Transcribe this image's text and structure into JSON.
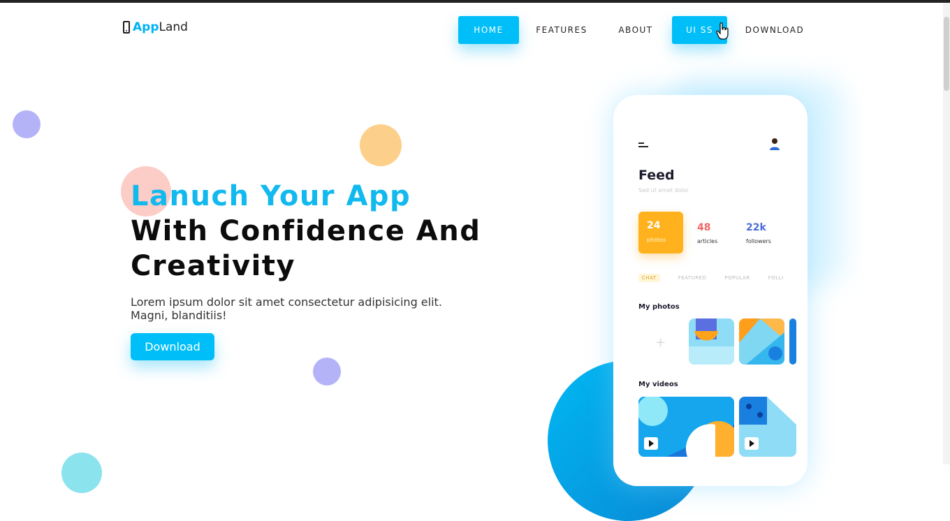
{
  "logo": {
    "app": "App",
    "land": "Land"
  },
  "nav": {
    "items": [
      {
        "label": "HOME",
        "active": true
      },
      {
        "label": "FEATURES",
        "active": false
      },
      {
        "label": "ABOUT",
        "active": false
      },
      {
        "label": "UI SS",
        "active": true
      },
      {
        "label": "DOWNLOAD",
        "active": false
      }
    ]
  },
  "hero": {
    "line1": "Lanuch Your App",
    "line2": "With Confidence And",
    "line3": "Creativity",
    "description": "Lorem ipsum dolor sit amet consectetur adipisicing elit. Magni, blanditiis!",
    "button_label": "Download"
  },
  "phone": {
    "feed_title": "Feed",
    "feed_subtitle": "Sed ut amet dolor",
    "stats": [
      {
        "value": "24",
        "label": "photos"
      },
      {
        "value": "48",
        "label": "articles"
      },
      {
        "value": "22k",
        "label": "followers"
      }
    ],
    "tabs": [
      "CHAT",
      "FEATURED",
      "POPULAR",
      "FOLLI"
    ],
    "my_photos_label": "My photos",
    "my_videos_label": "My videos"
  },
  "colors": {
    "accent": "#00bff8",
    "title_blue": "#12b9ef",
    "stat_orange": "#ffb21e",
    "stat_red": "#f26565",
    "stat_blue": "#4a6cd8"
  },
  "icons": {
    "logo": "phone-icon",
    "cursor": "hand-cursor-icon",
    "menu": "menu-icon",
    "add": "plus-icon",
    "play": "play-icon"
  }
}
